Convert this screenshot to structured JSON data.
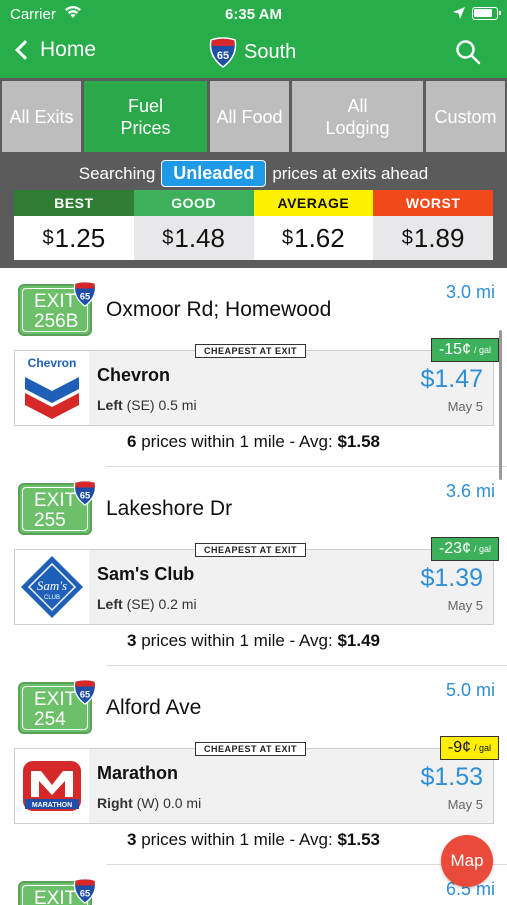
{
  "status": {
    "carrier": "Carrier",
    "time": "6:35 AM"
  },
  "nav": {
    "back_label": "Home",
    "route_number": "65",
    "direction": "South"
  },
  "tabs": [
    {
      "label": "All Exits",
      "active": false
    },
    {
      "label": "Fuel Prices",
      "active": true
    },
    {
      "label": "All Food",
      "active": false
    },
    {
      "label": "All Lodging",
      "active": false
    },
    {
      "label": "Custom",
      "active": false
    }
  ],
  "search": {
    "prefix": "Searching",
    "fuel_type": "Unleaded",
    "suffix": "prices at exits ahead"
  },
  "price_summary": [
    {
      "label": "BEST",
      "dollar": "$",
      "value": "1.25",
      "color": "#2e7d32"
    },
    {
      "label": "GOOD",
      "dollar": "$",
      "value": "1.48",
      "color": "#3cb05a"
    },
    {
      "label": "AVERAGE",
      "dollar": "$",
      "value": "1.62",
      "color": "#fff200"
    },
    {
      "label": "WORST",
      "dollar": "$",
      "value": "1.89",
      "color": "#f04a1a"
    }
  ],
  "exits": [
    {
      "exit_label": "EXIT",
      "exit_number": "256B",
      "route": "65",
      "name": "Oxmoor Rd; Homewood",
      "distance": "3.0 mi",
      "station": {
        "brand": "Chevron",
        "logo": "chevron-logo",
        "side": "Left",
        "side_detail": "(SE) 0.5 mi",
        "price": "$1.47",
        "date": "May 5",
        "badge": "CHEAPEST AT EXIT",
        "savings": "-15¢",
        "savings_unit": "/ gal",
        "savings_color": "green"
      },
      "summary_count": "6",
      "summary_text": "prices within 1 mile - Avg:",
      "summary_avg": "$1.58"
    },
    {
      "exit_label": "EXIT",
      "exit_number": "255",
      "route": "65",
      "name": "Lakeshore Dr",
      "distance": "3.6 mi",
      "station": {
        "brand": "Sam's Club",
        "logo": "sams-club-logo",
        "side": "Left",
        "side_detail": "(SE) 0.2 mi",
        "price": "$1.39",
        "date": "May 5",
        "badge": "CHEAPEST AT EXIT",
        "savings": "-23¢",
        "savings_unit": "/ gal",
        "savings_color": "green"
      },
      "summary_count": "3",
      "summary_text": "prices within 1 mile - Avg:",
      "summary_avg": "$1.49"
    },
    {
      "exit_label": "EXIT",
      "exit_number": "254",
      "route": "65",
      "name": "Alford Ave",
      "distance": "5.0 mi",
      "station": {
        "brand": "Marathon",
        "logo": "marathon-logo",
        "side": "Right",
        "side_detail": "(W) 0.0 mi",
        "price": "$1.53",
        "date": "May 5",
        "badge": "CHEAPEST AT EXIT",
        "savings": "-9¢",
        "savings_unit": "/ gal",
        "savings_color": "yellow"
      },
      "summary_count": "3",
      "summary_text": "prices within 1 mile - Avg:",
      "summary_avg": "$1.53"
    },
    {
      "exit_label": "EXIT",
      "exit_number": "",
      "route": "65",
      "name": "",
      "distance": "6.5 mi"
    }
  ],
  "map_button": "Map"
}
